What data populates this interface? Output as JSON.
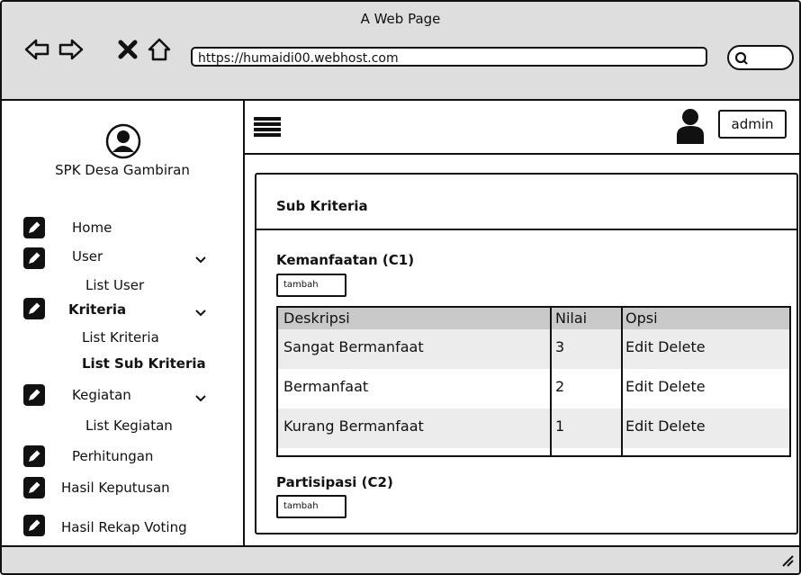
{
  "window": {
    "title": "A Web Page",
    "url": "https://humaidi00.webhost.com"
  },
  "sidebar": {
    "brand": "SPK Desa Gambiran",
    "items": [
      {
        "label": "Home"
      },
      {
        "label": "User"
      },
      {
        "label": "List User"
      },
      {
        "label": "Kriteria"
      },
      {
        "label": "List Kriteria"
      },
      {
        "label": "List Sub Kriteria"
      },
      {
        "label": "Kegiatan"
      },
      {
        "label": "List Kegiatan"
      },
      {
        "label": "Perhitungan"
      },
      {
        "label": "Hasil Keputusan"
      },
      {
        "label": "Hasil Rekap Voting"
      }
    ]
  },
  "header": {
    "username": "admin"
  },
  "main": {
    "title": "Sub Kriteria",
    "sections": [
      {
        "title": "Kemanfaatan (C1)",
        "add_label": "tambah",
        "columns": [
          "Deskripsi",
          "Nilai",
          "Opsi"
        ],
        "rows": [
          {
            "deskripsi": "Sangat Bermanfaat",
            "nilai": "3",
            "opsi": "Edit Delete"
          },
          {
            "deskripsi": "Bermanfaat",
            "nilai": "2",
            "opsi": "Edit Delete"
          },
          {
            "deskripsi": "Kurang Bermanfaat",
            "nilai": "1",
            "opsi": "Edit Delete"
          }
        ]
      },
      {
        "title": "Partisipasi (C2)",
        "add_label": "tambah"
      }
    ]
  }
}
